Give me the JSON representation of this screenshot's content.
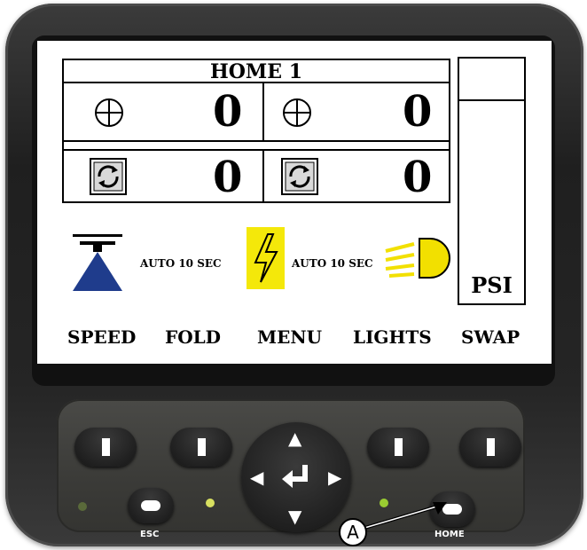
{
  "display": {
    "title": "HOME 1",
    "counters": [
      {
        "icon": "crosshair-icon",
        "value": "0"
      },
      {
        "icon": "crosshair-icon",
        "value": "0"
      },
      {
        "icon": "rotate-icon",
        "value": "0"
      },
      {
        "icon": "rotate-icon",
        "value": "0"
      }
    ],
    "psi_label": "PSI",
    "status": [
      {
        "icon": "spray-nozzle-icon",
        "text": "AUTO 10 SEC"
      },
      {
        "icon": "lightning-icon",
        "text": "AUTO 10 SEC"
      },
      {
        "icon": "headlight-icon"
      }
    ],
    "softkeys": [
      "SPEED",
      "FOLD",
      "MENU",
      "LIGHTS",
      "SWAP"
    ]
  },
  "keypad": {
    "esc_label": "ESC",
    "home_label": "HOME",
    "callout": "A"
  },
  "colors": {
    "nozzle_blue": "#1f3c8c",
    "bolt_yellow": "#f4e80a",
    "lamp_yellow": "#f2e000",
    "led_green": "#9acd32"
  }
}
